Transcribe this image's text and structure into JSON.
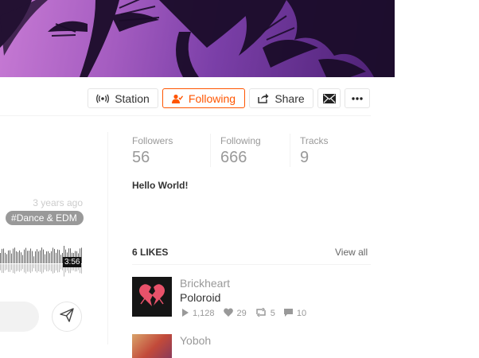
{
  "colors": {
    "accent": "#ff5500",
    "muted": "#999999",
    "border": "#e5e5e5"
  },
  "actions": {
    "station_label": "Station",
    "following_label": "Following",
    "share_label": "Share"
  },
  "stats": [
    {
      "label": "Followers",
      "value": "56"
    },
    {
      "label": "Following",
      "value": "666"
    },
    {
      "label": "Tracks",
      "value": "9"
    }
  ],
  "bio": "Hello World!",
  "track": {
    "posted": "3 years ago",
    "tag": "Dance & EDM",
    "duration": "3:56"
  },
  "likes": {
    "title": "6 LIKES",
    "view_all": "View all",
    "items": [
      {
        "artist": "Brickheart",
        "title": "Poloroid",
        "plays": "1,128",
        "likes": "29",
        "reposts": "5",
        "comments": "10",
        "artwork_icon": "broken-heart-icon"
      },
      {
        "artist": "Yoboh"
      }
    ]
  }
}
